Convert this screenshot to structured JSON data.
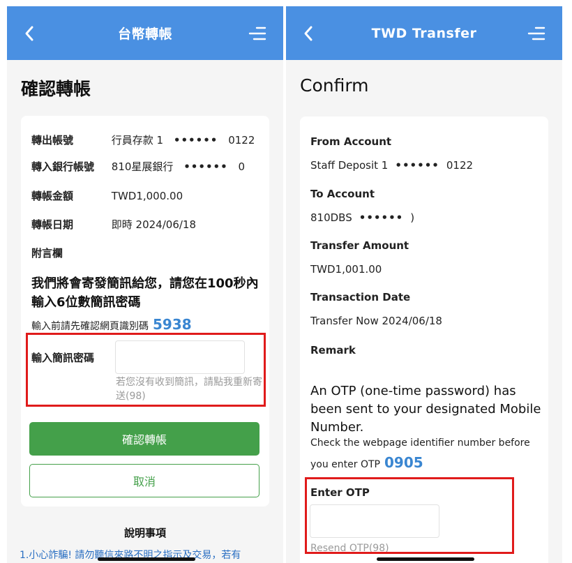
{
  "left": {
    "header_title": "台幣轉帳",
    "page_title": "確認轉帳",
    "rows": [
      {
        "label": "轉出帳號",
        "value_pre": "行員存款 1",
        "value_dots": "••••••",
        "value_post": "0122"
      },
      {
        "label": "轉入銀行帳號",
        "value_pre": "810星展銀行",
        "value_dots": "••••••",
        "value_post": "0"
      },
      {
        "label": "轉帳金額",
        "value_pre": "TWD1,000.00",
        "value_dots": "",
        "value_post": ""
      },
      {
        "label": "轉帳日期",
        "value_pre": "即時 2024/06/18",
        "value_dots": "",
        "value_post": ""
      },
      {
        "label": "附言欄",
        "value_pre": "",
        "value_dots": "",
        "value_post": ""
      }
    ],
    "notice": "我們將會寄發簡訊給您，請您在100秒內輸入6位數簡訊密碼",
    "identifier_text": "輸入前請先確認網頁識別碼",
    "identifier_code": "5938",
    "otp_label": "輸入簡訊密碼",
    "resend_text": "若您沒有收到簡訊，請點我重新寄送(98)",
    "confirm_button": "確認轉帳",
    "cancel_button": "取消",
    "notes_title": "說明事項",
    "notes_text": "1.小心詐騙! 請勿聽信來路不明之指示及交易，若有"
  },
  "right": {
    "header_title": "TWD Transfer",
    "page_title": "Confirm",
    "fields": [
      {
        "label": "From Account",
        "value_pre": "Staff Deposit 1",
        "value_dots": "••••••",
        "value_post": "0122"
      },
      {
        "label": "To Account",
        "value_pre": "810DBS",
        "value_dots": "••••••",
        "value_post": ")"
      },
      {
        "label": "Transfer Amount",
        "value_pre": "TWD1,001.00",
        "value_dots": "",
        "value_post": ""
      },
      {
        "label": "Transaction Date",
        "value_pre": "Transfer Now 2024/06/18",
        "value_dots": "",
        "value_post": ""
      },
      {
        "label": "Remark",
        "value_pre": "",
        "value_dots": "",
        "value_post": ""
      }
    ],
    "notice": "An OTP (one-time password) has been sent to your designated Mobile Number.",
    "identifier_text_1": "Check the webpage identifier number before",
    "identifier_text_2": "you enter OTP",
    "identifier_code": "0905",
    "otp_label": "Enter OTP",
    "resend_text": "Resend OTP(98)"
  },
  "icons": {
    "back": "chevron-left-icon",
    "menu": "menu-lines-icon"
  },
  "colors": {
    "header": "#4a90e2",
    "confirm": "#44a04a",
    "highlight": "#e01b1b",
    "code": "#3a86d1"
  }
}
